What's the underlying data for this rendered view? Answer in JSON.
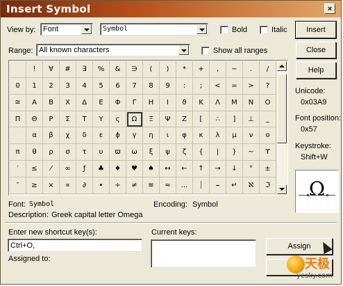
{
  "window": {
    "title": "Insert Symbol",
    "close_glyph": "×"
  },
  "view_by": {
    "label": "View by:",
    "value": "Font",
    "font_value": "Symbol"
  },
  "options": {
    "bold": "Bold",
    "italic": "Italic",
    "show_all_ranges": "Show all ranges"
  },
  "range": {
    "label": "Range:",
    "value": "All known characters"
  },
  "buttons": {
    "insert": "Insert",
    "close": "Close",
    "help": "Help",
    "assign": "Assign",
    "remove": "Re"
  },
  "symbols": [
    " ",
    "!",
    "∀",
    "#",
    "∃",
    "%",
    "&",
    "∋",
    "(",
    ")",
    "*",
    "+",
    ",",
    "−",
    ".",
    "/",
    "0",
    "1",
    "2",
    "3",
    "4",
    "5",
    "6",
    "7",
    "8",
    "9",
    ":",
    ";",
    "<",
    "=",
    ">",
    "?",
    "≅",
    "Α",
    "Β",
    "Χ",
    "Δ",
    "Ε",
    "Φ",
    "Γ",
    "Η",
    "Ι",
    "ϑ",
    "Κ",
    "Λ",
    "Μ",
    "Ν",
    "Ο",
    "Π",
    "Θ",
    "Ρ",
    "Σ",
    "Τ",
    "Υ",
    "ς",
    "Ω",
    "Ξ",
    "Ψ",
    "Ζ",
    "[",
    "∴",
    "]",
    "⊥",
    "_",
    "",
    "α",
    "β",
    "χ",
    "δ",
    "ε",
    "ϕ",
    "γ",
    "η",
    "ι",
    "φ",
    "κ",
    "λ",
    "μ",
    "ν",
    "ο",
    "π",
    "θ",
    "ρ",
    "σ",
    "τ",
    "υ",
    "ϖ",
    "ω",
    "ξ",
    "ψ",
    "ζ",
    "{",
    "|",
    "}",
    "~",
    "ϒ",
    "′",
    "≤",
    "⁄",
    "∞",
    "ƒ",
    "♣",
    "♦",
    "♥",
    "♠",
    "↔",
    "←",
    "↑",
    "→",
    "↓",
    "°",
    "±",
    "″",
    "≥",
    "×",
    "∝",
    "∂",
    "•",
    "÷",
    "≠",
    "≡",
    "≈",
    "…",
    "⏐",
    "⎯",
    "↵",
    "ℵ",
    "ℑ"
  ],
  "info": {
    "unicode_label": "Unicode:",
    "unicode_value": "0x03A9",
    "font_position_label": "Font position:",
    "font_position_value": "0x57",
    "keystroke_label": "Keystroke:",
    "keystroke_value": "Shift+W",
    "preview_glyph": "Ω"
  },
  "footer": {
    "font_label": "Font:",
    "font_value": "Symbol",
    "encoding_label": "Encoding:",
    "encoding_value": "Symbol",
    "description_label": "Description:",
    "description_value": "Greek capital letter Omega"
  },
  "shortcut": {
    "new_label": "Enter new shortcut key(s):",
    "new_value": "Ctrl+O,",
    "current_label": "Current keys:",
    "assigned_label": "Assigned to:"
  },
  "watermark": {
    "cn": "天极",
    "url": "yesky.com"
  }
}
